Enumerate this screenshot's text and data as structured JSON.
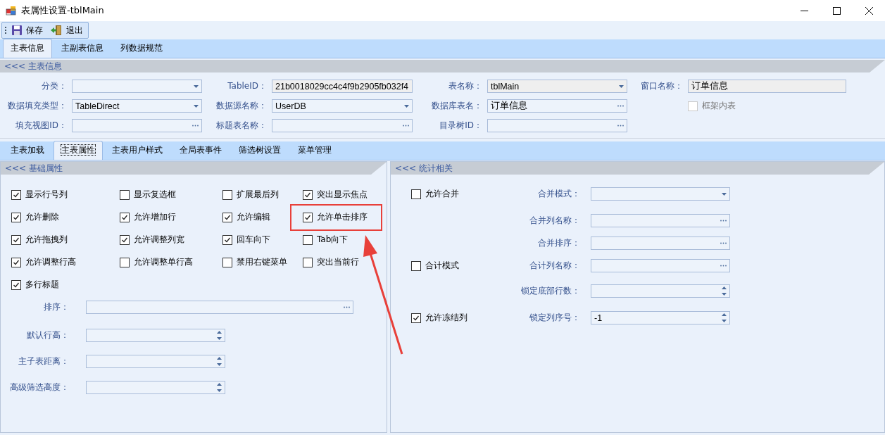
{
  "window": {
    "title": "表属性设置-tblMain"
  },
  "toolbar": {
    "buttons": [
      {
        "label": "保存",
        "kind": "save"
      },
      {
        "label": "退出",
        "kind": "exit"
      }
    ]
  },
  "tabs": [
    {
      "label": "主表信息",
      "selected": true
    },
    {
      "label": "主副表信息",
      "selected": false
    },
    {
      "label": "列数据规范",
      "selected": false
    }
  ],
  "main_section": {
    "title": "<<< 主表信息",
    "rows": [
      [
        {
          "label": "分类：",
          "kind": "combo",
          "readonly": false
        },
        {
          "label": "TableID：",
          "kind": "text",
          "value": "21b0018029cc4c4f9b2905fb032f4",
          "readonly": true
        },
        {
          "label": "表名称：",
          "kind": "combo",
          "value": "tblMain",
          "readonly": true
        },
        {
          "label": "窗口名称：",
          "kind": "text",
          "value": "订单信息",
          "readonly": true
        }
      ],
      [
        {
          "label": "数据填充类型：",
          "kind": "combo",
          "value": "TableDirect",
          "readonly": false
        },
        {
          "label": "数据源名称：",
          "kind": "combo",
          "value": "UserDB",
          "readonly": false
        },
        {
          "label": "数据库表名：",
          "kind": "browse",
          "value": "订单信息",
          "readonly": false
        },
        {
          "label": "框架内表",
          "kind": "checkbox",
          "checked": false,
          "disabled": true
        }
      ],
      [
        {
          "label": "填充视图ID：",
          "kind": "browse",
          "readonly": false
        },
        {
          "label": "标题表名称：",
          "kind": "browse",
          "readonly": false
        },
        {
          "label": "目录树ID：",
          "kind": "browse",
          "readonly": false
        }
      ]
    ]
  },
  "sub_tabs": [
    {
      "label": "主表加载",
      "selected": false
    },
    {
      "label": "主表属性",
      "selected": true
    },
    {
      "label": "主表用户样式",
      "selected": false
    },
    {
      "label": "全局表事件",
      "selected": false
    },
    {
      "label": "筛选树设置",
      "selected": false
    },
    {
      "label": "菜单管理",
      "selected": false
    }
  ],
  "basic_panel": {
    "title": "<<< 基础属性",
    "checkboxes": [
      {
        "label": "显示行号列",
        "checked": true
      },
      {
        "label": "显示复选框",
        "checked": false
      },
      {
        "label": "扩展最后列",
        "checked": false
      },
      {
        "label": "突出显示焦点",
        "checked": true
      },
      {
        "label": "允许删除",
        "checked": true
      },
      {
        "label": "允许增加行",
        "checked": true
      },
      {
        "label": "允许编辑",
        "checked": true
      },
      {
        "label": "允许单击排序",
        "checked": true
      },
      {
        "label": "允许拖拽列",
        "checked": true
      },
      {
        "label": "允许调整列宽",
        "checked": true
      },
      {
        "label": "回车向下",
        "checked": true
      },
      {
        "label": "Tab向下",
        "checked": false
      },
      {
        "label": "允许调整行高",
        "checked": true
      },
      {
        "label": "允许调整单行高",
        "checked": false
      },
      {
        "label": "禁用右键菜单",
        "checked": false
      },
      {
        "label": "突出当前行",
        "checked": false
      },
      {
        "label": "多行标题",
        "checked": true
      }
    ],
    "fields": [
      {
        "label": "排序：",
        "kind": "browse"
      },
      {
        "label": "默认行高：",
        "kind": "spin"
      },
      {
        "label": "主子表距离：",
        "kind": "spin"
      },
      {
        "label": "高级筛选高度：",
        "kind": "spin"
      }
    ]
  },
  "stats_panel": {
    "title": "<<< 统计相关",
    "rows": [
      {
        "checkbox": {
          "label": "允许合并",
          "checked": false
        },
        "field": {
          "label": "合并模式：",
          "kind": "combo"
        }
      },
      {
        "field": {
          "label": "合并列名称：",
          "kind": "browse"
        }
      },
      {
        "field": {
          "label": "合并排序：",
          "kind": "browse"
        }
      },
      {
        "checkbox": {
          "label": "合计模式",
          "checked": false
        },
        "field": {
          "label": "合计列名称：",
          "kind": "browse"
        }
      },
      {
        "field": {
          "label": "锁定底部行数：",
          "kind": "spin"
        }
      },
      {
        "checkbox": {
          "label": "允许冻结列",
          "checked": true
        },
        "field": {
          "label": "锁定列序号：",
          "kind": "spin",
          "value": "-1"
        }
      }
    ]
  }
}
